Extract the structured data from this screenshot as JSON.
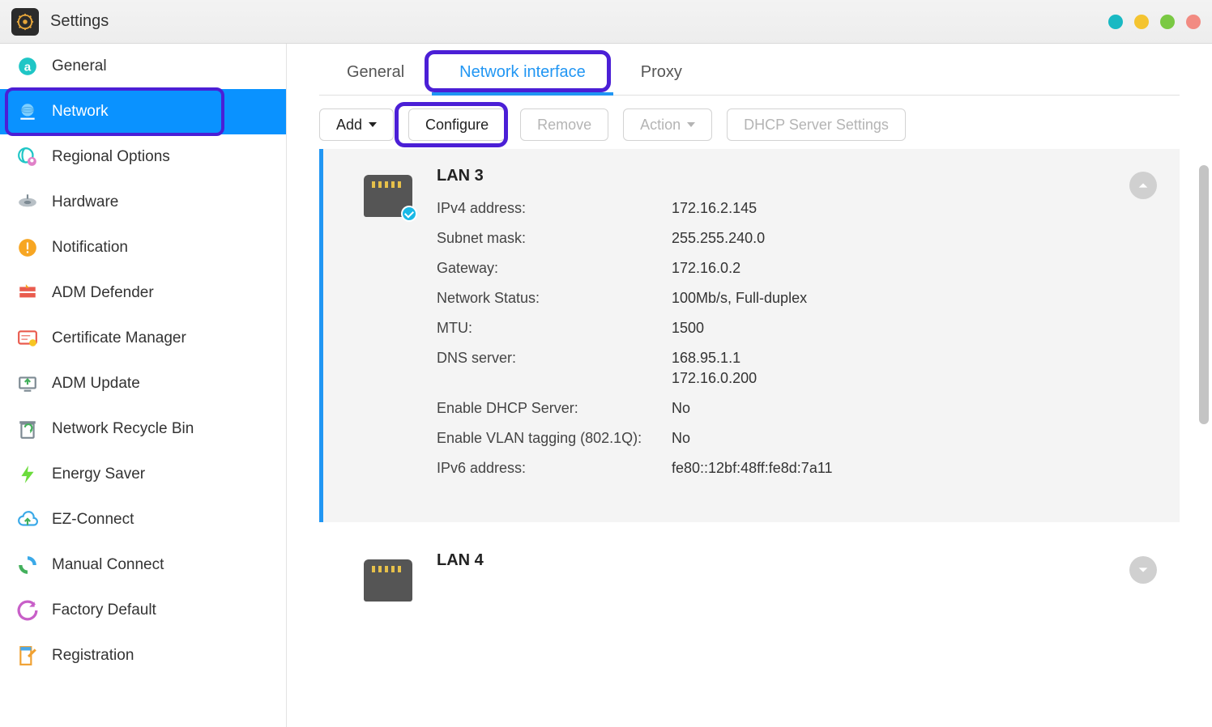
{
  "window": {
    "title": "Settings"
  },
  "sidebar": {
    "items": [
      {
        "label": "General"
      },
      {
        "label": "Network"
      },
      {
        "label": "Regional Options"
      },
      {
        "label": "Hardware"
      },
      {
        "label": "Notification"
      },
      {
        "label": "ADM Defender"
      },
      {
        "label": "Certificate Manager"
      },
      {
        "label": "ADM Update"
      },
      {
        "label": "Network Recycle Bin"
      },
      {
        "label": "Energy Saver"
      },
      {
        "label": "EZ-Connect"
      },
      {
        "label": "Manual Connect"
      },
      {
        "label": "Factory Default"
      },
      {
        "label": "Registration"
      }
    ],
    "active_index": 1
  },
  "tabs": {
    "items": [
      {
        "label": "General"
      },
      {
        "label": "Network interface"
      },
      {
        "label": "Proxy"
      }
    ],
    "active_index": 1
  },
  "toolbar": {
    "add": "Add",
    "configure": "Configure",
    "remove": "Remove",
    "action": "Action",
    "dhcp": "DHCP Server Settings"
  },
  "interfaces": [
    {
      "name": "LAN 3",
      "expanded": true,
      "fields": {
        "ipv4_label": "IPv4 address:",
        "ipv4": "172.16.2.145",
        "mask_label": "Subnet mask:",
        "mask": "255.255.240.0",
        "gw_label": "Gateway:",
        "gw": "172.16.0.2",
        "status_label": "Network Status:",
        "status": "100Mb/s, Full-duplex",
        "mtu_label": "MTU:",
        "mtu": "1500",
        "dns_label": "DNS server:",
        "dns1": "168.95.1.1",
        "dns2": "172.16.0.200",
        "dhcp_label": "Enable DHCP Server:",
        "dhcp": "No",
        "vlan_label": "Enable VLAN tagging (802.1Q):",
        "vlan": "No",
        "ipv6_label": "IPv6 address:",
        "ipv6": "fe80::12bf:48ff:fe8d:7a11"
      }
    },
    {
      "name": "LAN 4",
      "expanded": false
    }
  ]
}
